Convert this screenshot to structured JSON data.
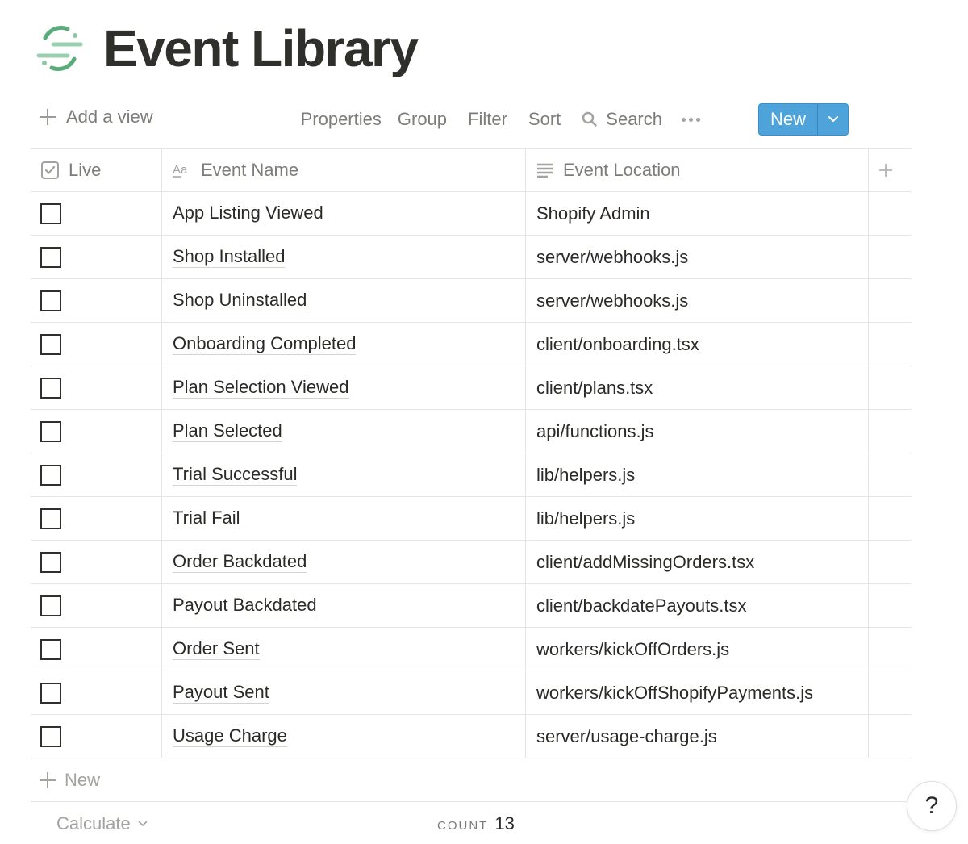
{
  "page": {
    "title": "Event Library",
    "logo_icon": "segment-logo-icon",
    "accent_color": "#5aac7b"
  },
  "toolbar": {
    "add_view_label": "Add a view",
    "properties_label": "Properties",
    "group_label": "Group",
    "filter_label": "Filter",
    "sort_label": "Sort",
    "search_label": "Search",
    "more_icon": "more-horizontal-icon",
    "new_label": "New",
    "new_button_color": "#4ea3db"
  },
  "table": {
    "columns": [
      {
        "label": "Live",
        "icon": "checkbox-property-icon"
      },
      {
        "label": "Event Name",
        "icon": "title-property-icon"
      },
      {
        "label": "Event Location",
        "icon": "text-property-icon"
      }
    ],
    "rows": [
      {
        "live": false,
        "name": "App Listing Viewed",
        "location": "Shopify Admin"
      },
      {
        "live": false,
        "name": "Shop Installed",
        "location": "server/webhooks.js"
      },
      {
        "live": false,
        "name": "Shop Uninstalled",
        "location": "server/webhooks.js"
      },
      {
        "live": false,
        "name": "Onboarding Completed",
        "location": "client/onboarding.tsx"
      },
      {
        "live": false,
        "name": "Plan Selection Viewed",
        "location": "client/plans.tsx"
      },
      {
        "live": false,
        "name": "Plan Selected",
        "location": "api/functions.js"
      },
      {
        "live": false,
        "name": "Trial Successful",
        "location": "lib/helpers.js"
      },
      {
        "live": false,
        "name": "Trial Fail",
        "location": "lib/helpers.js"
      },
      {
        "live": false,
        "name": "Order Backdated",
        "location": "client/addMissingOrders.tsx"
      },
      {
        "live": false,
        "name": "Payout Backdated",
        "location": "client/backdatePayouts.tsx"
      },
      {
        "live": false,
        "name": "Order Sent",
        "location": "workers/kickOffOrders.js"
      },
      {
        "live": false,
        "name": "Payout Sent",
        "location": "workers/kickOffShopifyPayments.js"
      },
      {
        "live": false,
        "name": "Usage Charge",
        "location": "server/usage-charge.js"
      }
    ],
    "add_row_label": "New"
  },
  "footer": {
    "calculate_label": "Calculate",
    "count_label": "COUNT",
    "count_value": "13"
  },
  "help": {
    "label": "?"
  }
}
